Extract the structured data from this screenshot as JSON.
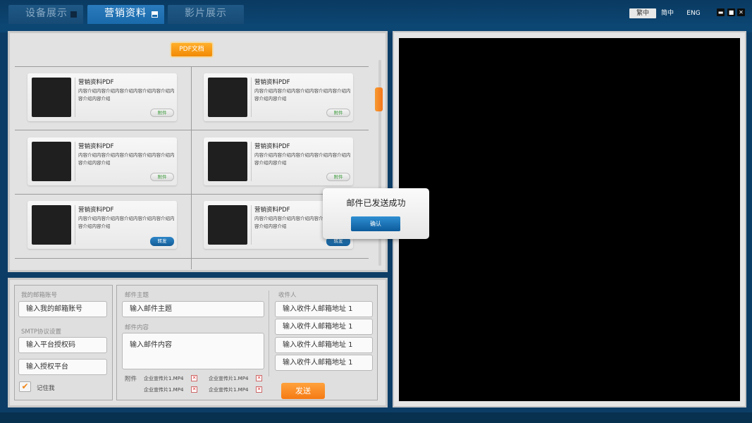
{
  "tabs": [
    {
      "label": "设备展示",
      "active": false
    },
    {
      "label": "营销资料",
      "active": true
    },
    {
      "label": "影片展示",
      "active": false
    }
  ],
  "languages": [
    "繁中",
    "简中",
    "ENG"
  ],
  "selected_language": "繁中",
  "window_controls": {
    "minimize": "▬",
    "maximize": "■",
    "close": "✕"
  },
  "pdf_section": {
    "button_label": "PDF文档"
  },
  "cards": [
    {
      "title": "营销资料PDF",
      "desc": "内容介绍内容介绍内容介绍内容介绍内容介绍内容介绍内容介绍",
      "action": "附件"
    },
    {
      "title": "营销资料PDF",
      "desc": "内容介绍内容介绍内容介绍内容介绍内容介绍内容介绍内容介绍",
      "action": "附件"
    },
    {
      "title": "营销资料PDF",
      "desc": "内容介绍内容介绍内容介绍内容介绍内容介绍内容介绍内容介绍",
      "action": "附件"
    },
    {
      "title": "营销资料PDF",
      "desc": "内容介绍内容介绍内容介绍内容介绍内容介绍内容介绍内容介绍",
      "action": "附件"
    },
    {
      "title": "营销资料PDF",
      "desc": "内容介绍内容介绍内容介绍内容介绍内容介绍内容介绍内容介绍",
      "action": "转发"
    },
    {
      "title": "营销资料PDF",
      "desc": "内容介绍内容介绍内容介绍内容介绍内容介绍内容介绍内容介绍",
      "action": "转发"
    }
  ],
  "dialog": {
    "message": "邮件已发送成功",
    "confirm": "确认"
  },
  "account": {
    "email_label": "我的邮箱账号",
    "email_placeholder": "输入我的邮箱账号",
    "smtp_label": "SMTP协议设置",
    "auth_code_placeholder": "输入平台授权码",
    "auth_platform_placeholder": "输入授权平台",
    "remember": "记住我",
    "remember_checked": true
  },
  "mail": {
    "subject_label": "邮件主题",
    "subject_placeholder": "输入邮件主题",
    "content_label": "邮件内容",
    "content_placeholder": "输入邮件内容",
    "attach_label": "附件",
    "attachments": [
      "企业宣传片1.MP4",
      "企业宣传片1.MP4",
      "企业宣传片1.MP4",
      "企业宣传片1.MP4"
    ],
    "remove_icon": "✕"
  },
  "recipients": {
    "label": "收件人",
    "fields": [
      "输入收件人邮箱地址 1",
      "输入收件人邮箱地址 1",
      "输入收件人邮箱地址 1",
      "输入收件人邮箱地址 1"
    ],
    "send": "发送"
  },
  "colors": {
    "accent": "#f28a05",
    "primary": "#1a6aab",
    "bg": "#0c3d66"
  }
}
